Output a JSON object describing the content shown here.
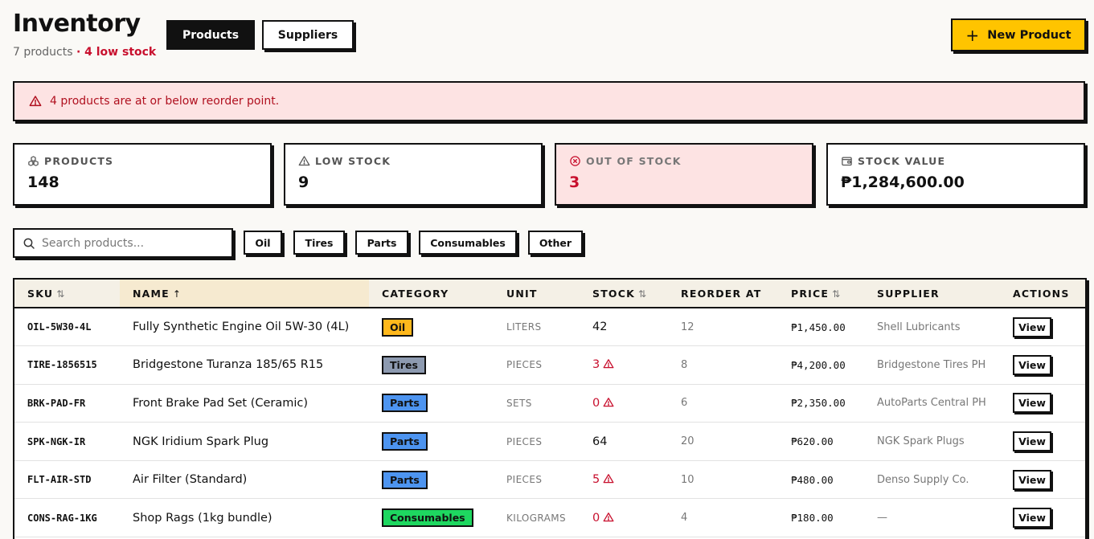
{
  "header": {
    "title": "Inventory",
    "product_count": "7 products",
    "low_stock_note": "· 4 low stock",
    "tabs": [
      {
        "label": "Products",
        "active": true
      },
      {
        "label": "Suppliers",
        "active": false
      }
    ],
    "new_product_label": "New Product"
  },
  "alert": {
    "message": "4 products are at or below reorder point."
  },
  "stats": [
    {
      "label": "PRODUCTS",
      "value": "148",
      "icon": "boxes-icon"
    },
    {
      "label": "LOW STOCK",
      "value": "9",
      "icon": "warning-icon"
    },
    {
      "label": "OUT OF STOCK",
      "value": "3",
      "icon": "x-circle-icon"
    },
    {
      "label": "STOCK VALUE",
      "value": "₱1,284,600.00",
      "icon": "wallet-icon"
    }
  ],
  "search": {
    "placeholder": "Search products..."
  },
  "filters": [
    "Oil",
    "Tires",
    "Parts",
    "Consumables",
    "Other"
  ],
  "table": {
    "columns": [
      "SKU",
      "NAME",
      "CATEGORY",
      "UNIT",
      "STOCK",
      "REORDER AT",
      "PRICE",
      "SUPPLIER",
      "ACTIONS"
    ],
    "rows": [
      {
        "sku": "OIL-5W30-4L",
        "name": "Fully Synthetic Engine Oil 5W-30 (4L)",
        "category": "Oil",
        "unit": "LITERS",
        "stock": "42",
        "low": false,
        "reorder": "12",
        "price": "₱1,450.00",
        "supplier": "Shell Lubricants",
        "action": "View"
      },
      {
        "sku": "TIRE-1856515",
        "name": "Bridgestone Turanza 185/65 R15",
        "category": "Tires",
        "unit": "PIECES",
        "stock": "3",
        "low": true,
        "reorder": "8",
        "price": "₱4,200.00",
        "supplier": "Bridgestone Tires PH",
        "action": "View"
      },
      {
        "sku": "BRK-PAD-FR",
        "name": "Front Brake Pad Set (Ceramic)",
        "category": "Parts",
        "unit": "SETS",
        "stock": "0",
        "low": true,
        "reorder": "6",
        "price": "₱2,350.00",
        "supplier": "AutoParts Central PH",
        "action": "View"
      },
      {
        "sku": "SPK-NGK-IR",
        "name": "NGK Iridium Spark Plug",
        "category": "Parts",
        "unit": "PIECES",
        "stock": "64",
        "low": false,
        "reorder": "20",
        "price": "₱620.00",
        "supplier": "NGK Spark Plugs",
        "action": "View"
      },
      {
        "sku": "FLT-AIR-STD",
        "name": "Air Filter (Standard)",
        "category": "Parts",
        "unit": "PIECES",
        "stock": "5",
        "low": true,
        "reorder": "10",
        "price": "₱480.00",
        "supplier": "Denso Supply Co.",
        "action": "View"
      },
      {
        "sku": "CONS-RAG-1KG",
        "name": "Shop Rags (1kg bundle)",
        "category": "Consumables",
        "unit": "KILOGRAMS",
        "stock": "0",
        "low": true,
        "reorder": "4",
        "price": "₱180.00",
        "supplier": "—",
        "action": "View"
      }
    ]
  },
  "colors": {
    "accent": "#ffc400",
    "danger": "#c8102e",
    "alert_bg": "#fde3e3",
    "category_oil": "#ffb81c",
    "category_tires": "#8d9ab0",
    "category_parts": "#4d94f0",
    "category_consumables": "#1ed760"
  }
}
